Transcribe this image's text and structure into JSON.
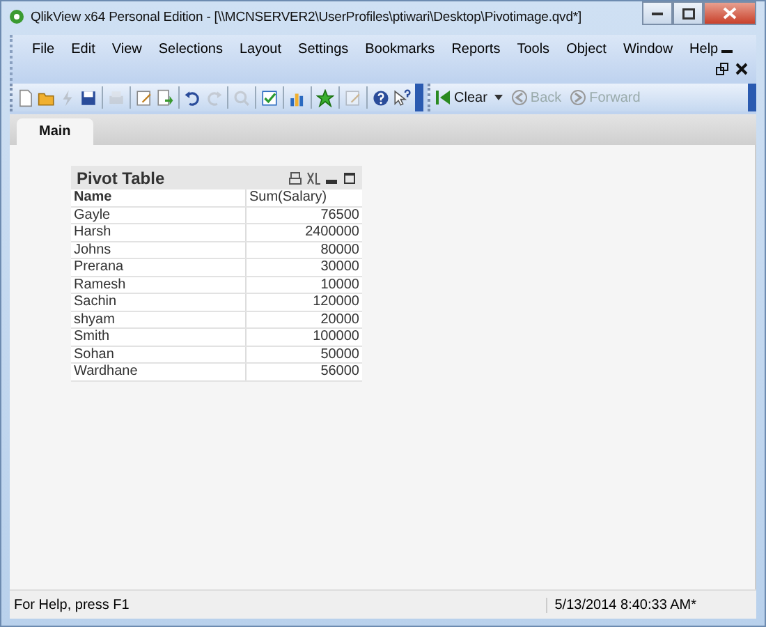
{
  "window": {
    "title": "QlikView x64 Personal Edition - [\\\\MCNSERVER2\\UserProfiles\\ptiwari\\Desktop\\Pivotimage.qvd*]"
  },
  "menu": [
    "File",
    "Edit",
    "View",
    "Selections",
    "Layout",
    "Settings",
    "Bookmarks",
    "Reports",
    "Tools",
    "Object",
    "Window",
    "Help"
  ],
  "toolbar": [
    {
      "kind": "new",
      "disabled": false
    },
    {
      "kind": "open",
      "disabled": false
    },
    {
      "kind": "reload",
      "disabled": true
    },
    {
      "kind": "save",
      "disabled": false
    },
    {
      "kind": "sep"
    },
    {
      "kind": "print",
      "disabled": true
    },
    {
      "kind": "sep"
    },
    {
      "kind": "edit",
      "disabled": false
    },
    {
      "kind": "export",
      "disabled": false
    },
    {
      "kind": "sep"
    },
    {
      "kind": "undo",
      "disabled": false
    },
    {
      "kind": "redo",
      "disabled": true
    },
    {
      "kind": "sep"
    },
    {
      "kind": "search",
      "disabled": true
    },
    {
      "kind": "sep"
    },
    {
      "kind": "check",
      "disabled": false
    },
    {
      "kind": "sep"
    },
    {
      "kind": "chart",
      "disabled": false
    },
    {
      "kind": "sep"
    },
    {
      "kind": "star",
      "disabled": false
    },
    {
      "kind": "sep"
    },
    {
      "kind": "edit",
      "disabled": true
    },
    {
      "kind": "sep"
    },
    {
      "kind": "help",
      "disabled": false
    },
    {
      "kind": "whatsthis",
      "disabled": false
    }
  ],
  "nav": [
    {
      "label": "Clear",
      "disabled": false,
      "dropdown": true
    },
    {
      "label": "Back",
      "disabled": true
    },
    {
      "label": "Forward",
      "disabled": true
    }
  ],
  "tabs": [
    {
      "label": "Main",
      "selected": true
    }
  ],
  "pivot": {
    "title": "Pivot Table",
    "columns": [
      "Name",
      "Sum(Salary)"
    ],
    "rows": [
      [
        "Gayle",
        "76500"
      ],
      [
        "Harsh",
        "2400000"
      ],
      [
        "Johns",
        "80000"
      ],
      [
        "Prerana",
        "30000"
      ],
      [
        "Ramesh",
        "10000"
      ],
      [
        "Sachin",
        "120000"
      ],
      [
        "shyam",
        "20000"
      ],
      [
        "Smith",
        "100000"
      ],
      [
        "Sohan",
        "50000"
      ],
      [
        "Wardhane",
        "56000"
      ]
    ]
  },
  "status_bar": {
    "help": "For Help, press F1",
    "timestamp": "5/13/2014 8:40:33 AM*"
  }
}
